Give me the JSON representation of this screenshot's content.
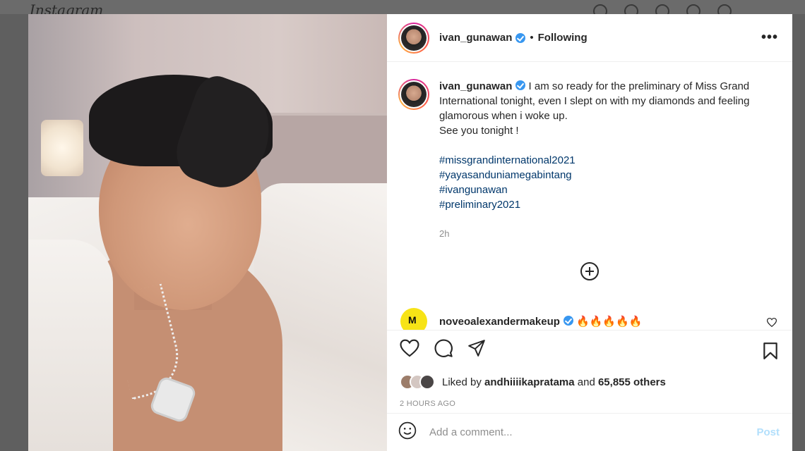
{
  "background": {
    "logo": "Instagram"
  },
  "post": {
    "author": "ivan_gunawan",
    "follow_status": "Following",
    "more_label": "•••",
    "dot": "•",
    "caption": {
      "author": "ivan_gunawan",
      "text": "I am so ready for the preliminary of Miss Grand International tonight, even I slept on with my diamonds and feeling glamorous when i woke up.",
      "line2": "See you tonight !",
      "hashtags": [
        "#missgrandinternational2021",
        "#yayasanduniamegabintang",
        "#ivangunawan",
        "#preliminary2021"
      ],
      "time": "2h"
    },
    "comment": {
      "author": "noveoalexandermakeup",
      "text": "🔥🔥🔥🔥🔥"
    },
    "likes": {
      "prefix": "Liked by",
      "user": "andhiiiikapratama",
      "middle": "and",
      "count": "65,855 others"
    },
    "posted_ago": "2 HOURS AGO",
    "add_comment": {
      "placeholder": "Add a comment...",
      "post_label": "Post"
    }
  },
  "colors": {
    "link": "#00376b",
    "verified": "#3897f0",
    "post_disabled": "#b2dffc"
  },
  "icons": [
    "heart-icon",
    "comment-icon",
    "share-icon",
    "bookmark-icon",
    "emoji-icon",
    "plus-circle-icon",
    "more-icon"
  ]
}
